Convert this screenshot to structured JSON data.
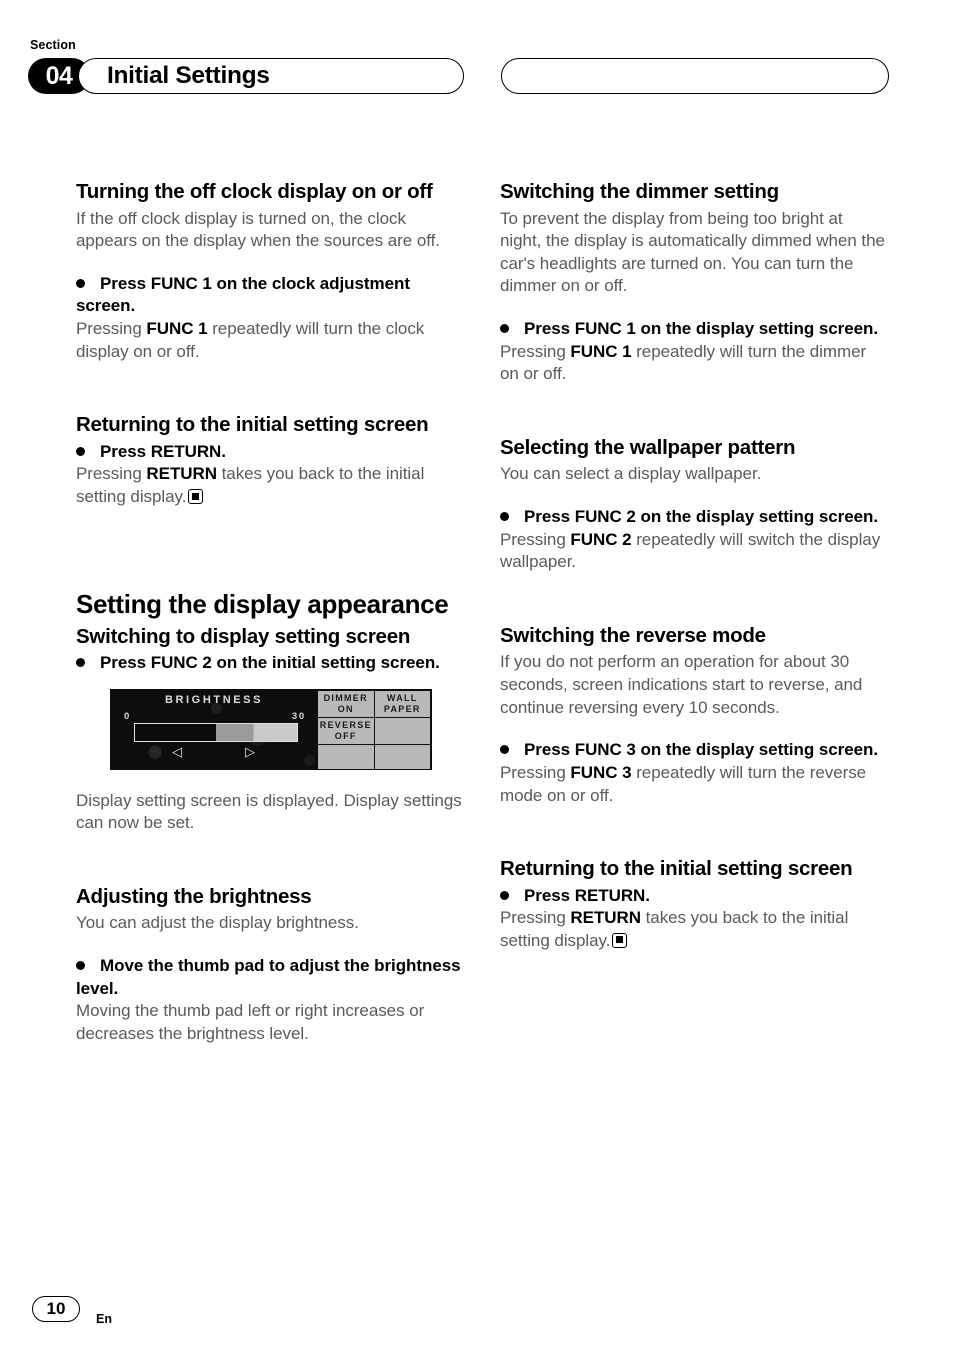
{
  "header": {
    "section_label": "Section",
    "section_number": "04",
    "title": "Initial Settings",
    "right_pill_text": ""
  },
  "left_column": [
    {
      "id": "turning-off-clock",
      "heading": "Turning the off clock display on or off",
      "intro": "If the off clock display is turned on, the clock appears on the display when the sources are off.",
      "instruction": "Press FUNC 1 on the clock adjustment screen.",
      "detail_pre": "Pressing ",
      "detail_bold": "FUNC 1",
      "detail_post": " repeatedly will turn the clock display on or off."
    },
    {
      "id": "returning-initial-setting",
      "heading": "Returning to the initial setting screen",
      "instruction": "Press RETURN.",
      "detail_pre": "Pressing ",
      "detail_bold": "RETURN",
      "detail_post": " takes you back to the initial setting display.",
      "end_marker": true
    },
    {
      "id": "setting-display-appearance",
      "heading_big": "Setting the display appearance",
      "heading": "Switching to display setting screen",
      "instruction": "Press FUNC 2 on the initial setting screen.",
      "caption": "Display setting screen is displayed. Display settings can now be set."
    },
    {
      "id": "adjusting-brightness",
      "heading": "Adjusting the brightness",
      "intro": "You can adjust the display brightness.",
      "instruction": "Move the thumb pad to adjust the brightness level.",
      "detail_pre": "Moving the thumb pad left or right increases or decreases the brightness level.",
      "detail_bold": "",
      "detail_post": ""
    }
  ],
  "right_column": [
    {
      "id": "switching-dimmer",
      "heading": "Switching the dimmer setting",
      "intro": "To prevent the display from being too bright at night, the display is automatically dimmed when the car's headlights are turned on. You can turn the dimmer on or off.",
      "instruction": "Press FUNC 1 on the display setting screen.",
      "detail_pre": "Pressing ",
      "detail_bold": "FUNC 1",
      "detail_post": " repeatedly will turn the dimmer on or off."
    },
    {
      "id": "selecting-wallpaper",
      "heading": "Selecting the wallpaper pattern",
      "intro": "You can select a display wallpaper.",
      "instruction": "Press FUNC 2 on the display setting screen.",
      "detail_pre": "Pressing ",
      "detail_bold": "FUNC 2",
      "detail_post": " repeatedly will switch the display wallpaper."
    },
    {
      "id": "switching-reverse-mode",
      "heading": "Switching the reverse mode",
      "intro": "If you do not perform an operation for about 30 seconds, screen indications start to reverse, and continue reversing every 10 seconds.",
      "instruction": "Press FUNC 3 on the display setting screen.",
      "detail_pre": "Pressing ",
      "detail_bold": "FUNC 3",
      "detail_post": " repeatedly will turn the reverse mode on or off."
    },
    {
      "id": "returning-initial-setting-2",
      "heading": "Returning to the initial setting screen",
      "instruction": "Press RETURN.",
      "detail_pre": "Pressing ",
      "detail_bold": "RETURN",
      "detail_post": " takes you back to the initial setting display.",
      "end_marker": true
    }
  ],
  "lcd_figure": {
    "name": "display-setting-screen",
    "title": "BRIGHTNESS",
    "scale_min": "0",
    "scale_max": "30",
    "bar_fill_percent": 50,
    "left_arrow": "◁",
    "right_arrow": "▷",
    "cells": [
      {
        "line1": "DIMMER",
        "line2": "ON"
      },
      {
        "line1": "WALL",
        "line2": "PAPER"
      },
      {
        "line1": "REVERSE",
        "line2": "OFF"
      },
      {
        "line1": "",
        "line2": ""
      },
      {
        "line1": "",
        "line2": ""
      },
      {
        "line1": "",
        "line2": ""
      }
    ]
  },
  "footer": {
    "page_number": "10",
    "language": "En"
  },
  "colors": {
    "text_body": "#5b5b5b",
    "text_heading": "#000000",
    "lcd_background": "#0d0d0d",
    "lcd_cell": "#b9b9b9"
  }
}
